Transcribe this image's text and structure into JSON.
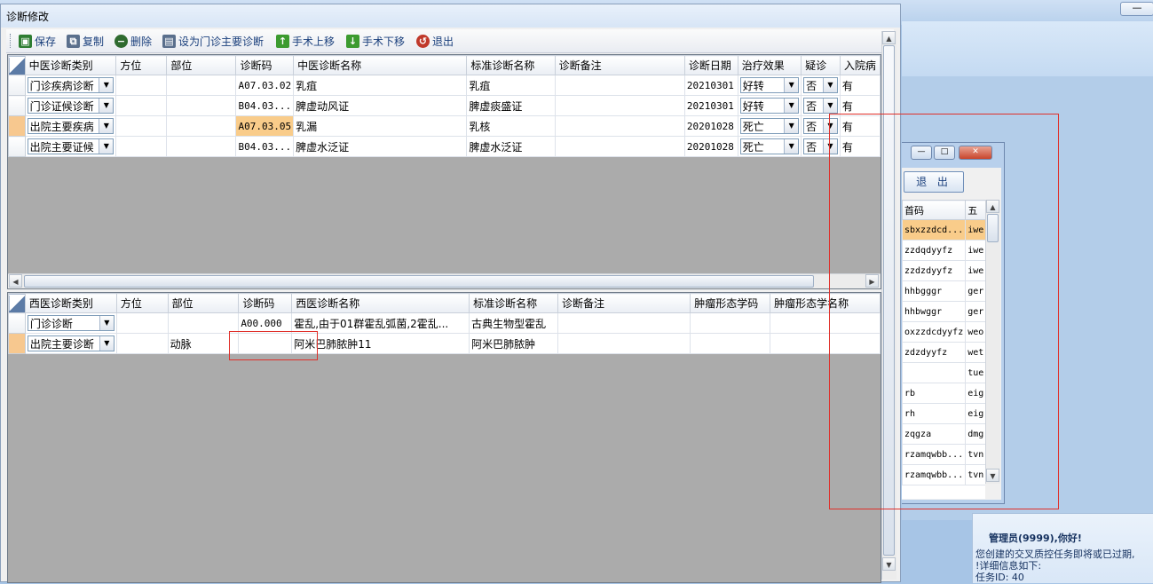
{
  "desktop": {
    "min_label": "—",
    "notice": {
      "greeting": "管理员(9999),你好!",
      "line1": "您创建的交叉质控任务即将或已过期,",
      "line2": "!详细信息如下:",
      "line3": "任务ID: 40"
    }
  },
  "window": {
    "title": "诊断修改",
    "toolbar": {
      "save": "保存",
      "copy": "复制",
      "delete": "删除",
      "set_main": "设为门诊主要诊断",
      "move_up": "手术上移",
      "move_down": "手术下移",
      "exit": "退出"
    },
    "tcm_grid": {
      "headers": [
        "中医诊断类别",
        "方位",
        "部位",
        "诊断码",
        "中医诊断名称",
        "标准诊断名称",
        "诊断备注",
        "诊断日期",
        "治疗效果",
        "疑诊",
        "入院病"
      ],
      "rows": [
        {
          "category": "门诊疾病诊断",
          "position": "",
          "site": "",
          "code": "A07.03.02",
          "name": "乳疽",
          "std_name": "乳疽",
          "note": "",
          "date": "20210301",
          "effect": "好转",
          "suspect": "否",
          "admit": "有"
        },
        {
          "category": "门诊证候诊断",
          "position": "",
          "site": "",
          "code": "B04.03...",
          "name": "脾虚动风证",
          "std_name": "脾虚痰盛证",
          "note": "",
          "date": "20210301",
          "effect": "好转",
          "suspect": "否",
          "admit": "有"
        },
        {
          "category": "出院主要疾病",
          "position": "",
          "site": "",
          "code": "A07.03.05",
          "name": "乳漏",
          "std_name": "乳核",
          "note": "",
          "date": "20201028",
          "effect": "死亡",
          "suspect": "否",
          "admit": "有"
        },
        {
          "category": "出院主要证候",
          "position": "",
          "site": "",
          "code": "B04.03...",
          "name": "脾虚水泛证",
          "std_name": "脾虚水泛证",
          "note": "",
          "date": "20201028",
          "effect": "死亡",
          "suspect": "否",
          "admit": "有"
        }
      ]
    },
    "wm_grid": {
      "headers": [
        "西医诊断类别",
        "方位",
        "部位",
        "诊断码",
        "西医诊断名称",
        "标准诊断名称",
        "诊断备注",
        "肿瘤形态学码",
        "肿瘤形态学名称"
      ],
      "rows": [
        {
          "category": "门诊诊断",
          "position": "",
          "site": "",
          "code": "A00.000",
          "name": "霍乱,由于01群霍乱弧菌,2霍乱...",
          "std_name": "古典生物型霍乱",
          "note": "",
          "morph_code": "",
          "morph_name": ""
        },
        {
          "category": "出院主要诊断",
          "position": "",
          "site": "动脉",
          "code": "",
          "name": "阿米巴肺脓肿11",
          "std_name": "阿米巴肺脓肿",
          "note": "",
          "morph_code": "",
          "morph_name": ""
        }
      ]
    }
  },
  "sub_window": {
    "exit_label": "退 出",
    "headers": [
      "首码",
      "五"
    ],
    "rows": [
      [
        "sbxzzdcd...",
        "iwe"
      ],
      [
        "zzdqdyyfz",
        "iwe"
      ],
      [
        "zzdzdyyfz",
        "iwe"
      ],
      [
        "hhbgggr",
        "ger"
      ],
      [
        "hhbwggr",
        "ger"
      ],
      [
        "oxzzdcdyyfz",
        "weo"
      ],
      [
        "zdzdyyfz",
        "wet"
      ],
      [
        "",
        "tue"
      ],
      [
        "rb",
        "eig"
      ],
      [
        "rh",
        "eig"
      ],
      [
        "zqgza",
        "dmg"
      ],
      [
        "rzamqwbb...",
        "tvn"
      ],
      [
        "rzamqwbb...",
        "tvn"
      ]
    ]
  },
  "colors": {
    "current_row": "#f7c88f",
    "highlight_cell": "#f9cc8a",
    "annotation_box": "#e0302a",
    "toolbar_text": "#1a3f7c"
  }
}
